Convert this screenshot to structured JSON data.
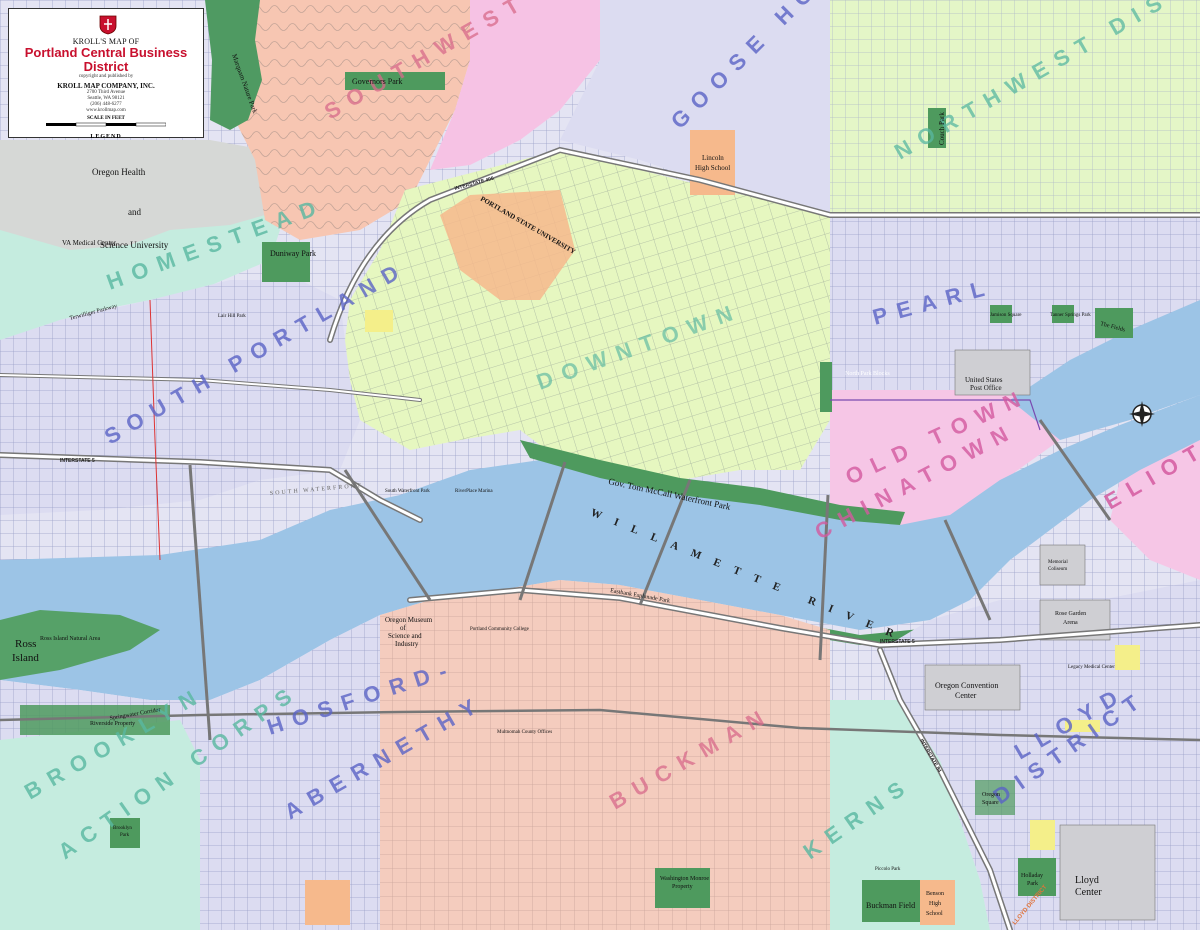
{
  "title_box": {
    "kicker": "KROLL'S MAP OF",
    "title": "Portland Central Business District",
    "copyright": "copyright and published by",
    "company": "KROLL MAP COMPANY, INC.",
    "address1": "2700 Third Avenue",
    "address2": "Seattle, WA 98121",
    "phone": "(206) 448-6277",
    "web": "www.krollmap.com",
    "scale": "SCALE IN FEET",
    "legend": "LEGEND"
  },
  "districts": {
    "southwest_hills": "SOUTHWEST HILLS",
    "goose_hollow": "GOOSE HOLLOW",
    "northwest_district": "NORTHWEST DISTRICT",
    "homestead": "HOMESTEAD",
    "pearl": "PEARL",
    "downtown": "DOWNTOWN",
    "south_portland": "SOUTH PORTLAND",
    "old_town": "OLD TOWN",
    "chinatown": "CHINATOWN",
    "eliot": "ELIOT",
    "hosford": "HOSFORD-",
    "abernethy": "ABERNETHY",
    "brooklyn": "BROOKLYN",
    "action_corps": "ACTION CORPS",
    "buckman": "BUCKMAN",
    "kerns": "KERNS",
    "lloyd": "LLOYD",
    "district": "DISTRICT"
  },
  "river": {
    "name": "WILLAMETTE RIVER"
  },
  "places": {
    "governors_park": "Governors Park",
    "marquam_park": "Marquam Nature Park",
    "ohsu_1": "Oregon Health",
    "ohsu_2": "and",
    "ohsu_3": "Science University",
    "va_center": "VA Medical Center",
    "duniway_park": "Duniway Park",
    "lincoln_hs_1": "Lincoln",
    "lincoln_hs_2": "High School",
    "psu": "PORTLAND STATE UNIVERSITY",
    "couch_park": "Couch Park",
    "jamison": "Jamison Square",
    "tanner": "Tanner Springs Park",
    "the_fields": "The Fields",
    "post_office_1": "United States",
    "post_office_2": "Post Office",
    "north_park_blocks": "North Park Blocks",
    "waterfront_park": "Gov. Tom McCall Waterfront Park",
    "eastbank": "Eastbank Esplanade Park",
    "omsi_1": "Oregon Museum",
    "omsi_2": "of",
    "omsi_3": "Science and",
    "omsi_4": "Industry",
    "pcc": "Portland Community College",
    "ross_island_1": "Ross",
    "ross_island_2": "Island",
    "ross_natural": "Ross Island Natural Area",
    "riverside": "Riverside Property",
    "springwater": "Springwater Corridor",
    "convention_1": "Oregon Convention",
    "convention_2": "Center",
    "memorial_coliseum_1": "Memorial",
    "memorial_coliseum_2": "Coliseum",
    "rose_garden_1": "Rose Garden",
    "rose_garden_2": "Arena",
    "legacy": "Legacy Medical Center",
    "oregon_square_1": "Oregon",
    "oregon_square_2": "Square",
    "holladay_1": "Holladay",
    "holladay_2": "Park",
    "lloyd_center_1": "Lloyd",
    "lloyd_center_2": "Center",
    "benson_1": "Benson",
    "benson_2": "High",
    "benson_3": "School",
    "buckman_field": "Buckman Field",
    "washington_monroe_1": "Washington Monroe",
    "washington_monroe_2": "Property",
    "multnomah": "Multnomah County Offices",
    "brooklyn_park_1": "Brooklyn",
    "brooklyn_park_2": "Park",
    "south_waterfront": "SOUTH WATERFRONT",
    "duniway_lair": "Lair Hill Park",
    "terwilliger": "Terwilliger Parkway",
    "riverplace": "RiverPlace Marina",
    "south_waterfront_park": "South Waterfront Park",
    "piccolo": "Piccolo Park"
  },
  "highways": {
    "i405": "INTERSTATE 405",
    "i5": "INTERSTATE 5",
    "i5b": "INTERSTATE 5",
    "i84": "INTERSTATE 84",
    "lloyd_dist": "LLOYD DISTRICT"
  },
  "colors": {
    "water": "#9cc4e4",
    "park": "#4e9a5e",
    "downtown": "#e7f7c0",
    "pearl": "#dcdcf2",
    "southwest": "#f7c9b5",
    "residential_east": "#f4cfc0",
    "oldtown": "#f4c4e6",
    "ohsu": "#d5d9d5",
    "teal": "#c7efe5",
    "accent": "#c8102e",
    "district_blue": "#5b64c6",
    "district_pink": "#d45aa0",
    "district_teal": "#59b8a1"
  }
}
